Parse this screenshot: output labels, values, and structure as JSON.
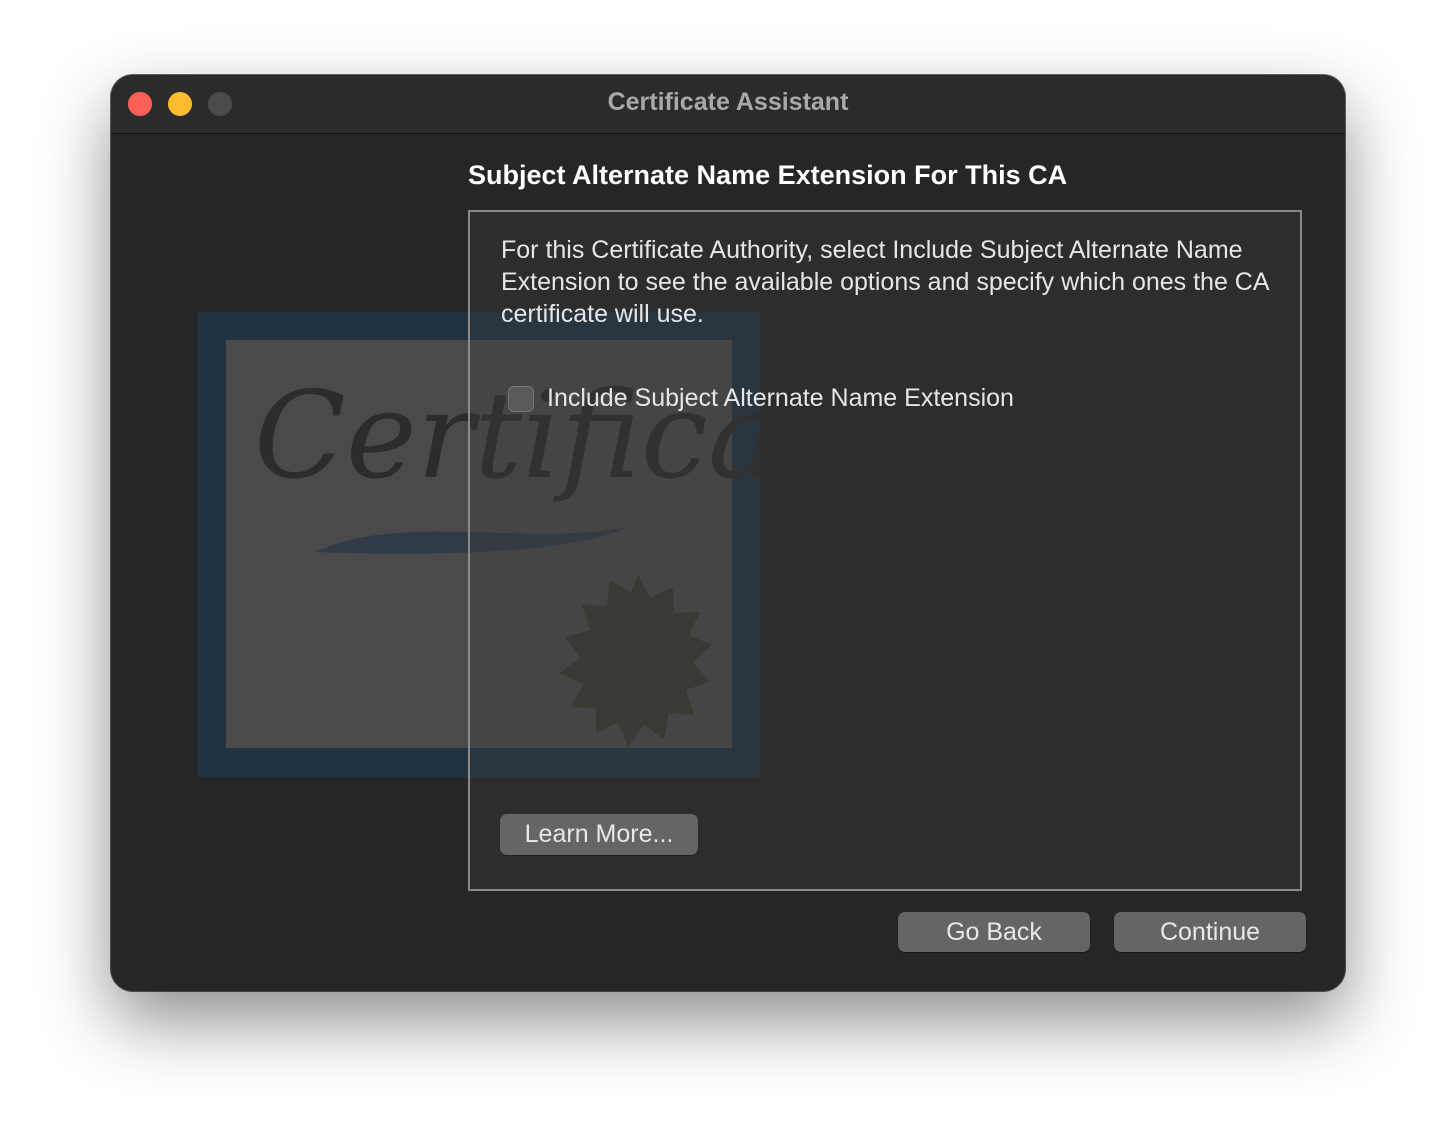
{
  "window": {
    "title": "Certificate Assistant"
  },
  "traffic_lights": {
    "close_color": "#fe5f57",
    "minimize_color": "#febc2e",
    "zoom_color": "#4b4b4b"
  },
  "page": {
    "heading": "Subject Alternate Name Extension For This CA",
    "description": "For this Certificate Authority, select Include Subject Alternate Name Extension to see the available options and specify which ones the CA certificate will use.",
    "checkbox": {
      "label": "Include Subject Alternate Name Extension",
      "checked": false
    },
    "learn_more_label": "Learn More..."
  },
  "buttons": {
    "go_back": "Go Back",
    "continue": "Continue"
  },
  "graphic": {
    "icon": "certificate-icon",
    "text": "Certificate"
  }
}
